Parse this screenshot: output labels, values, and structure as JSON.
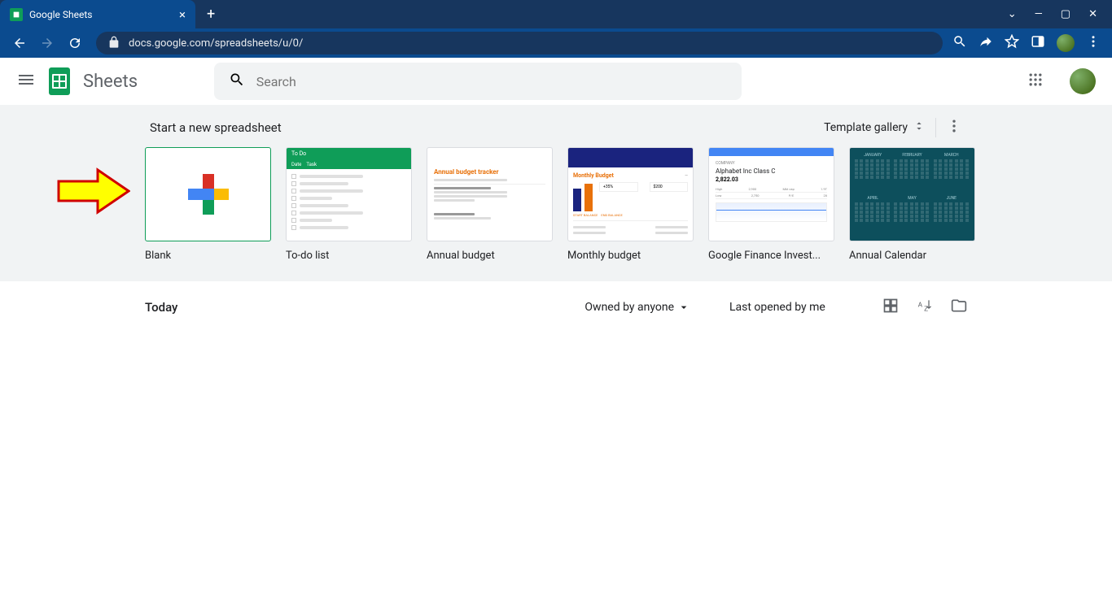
{
  "browser": {
    "tab_title": "Google Sheets",
    "url": "docs.google.com/spreadsheets/u/0/"
  },
  "app": {
    "title": "Sheets",
    "search_placeholder": "Search"
  },
  "templates": {
    "section_title": "Start a new spreadsheet",
    "gallery_link": "Template gallery",
    "items": [
      {
        "label": "Blank"
      },
      {
        "label": "To-do list"
      },
      {
        "label": "Annual budget"
      },
      {
        "label": "Monthly budget"
      },
      {
        "label": "Google Finance Invest..."
      },
      {
        "label": "Annual Calendar"
      }
    ],
    "thumb_text": {
      "todo_header": "To Do",
      "todo_tab_date": "Date",
      "todo_tab_task": "Task",
      "annual_title": "Annual budget tracker",
      "annual_sub": "Plan and track how you allocate spending for the year",
      "annual_conf": "Configure",
      "monthly_title": "Monthly Budget",
      "monthly_pct": "+35%",
      "monthly_amt": "$200",
      "finance_label": "COMPANY",
      "finance_name": "Alphabet Inc Class C",
      "finance_price": "2,822.03",
      "cal_months": [
        "JANUARY",
        "FEBRUARY",
        "MARCH",
        "APRIL",
        "MAY",
        "JUNE"
      ]
    }
  },
  "files": {
    "today_label": "Today",
    "owner_filter": "Owned by anyone",
    "sort_label": "Last opened by me"
  }
}
